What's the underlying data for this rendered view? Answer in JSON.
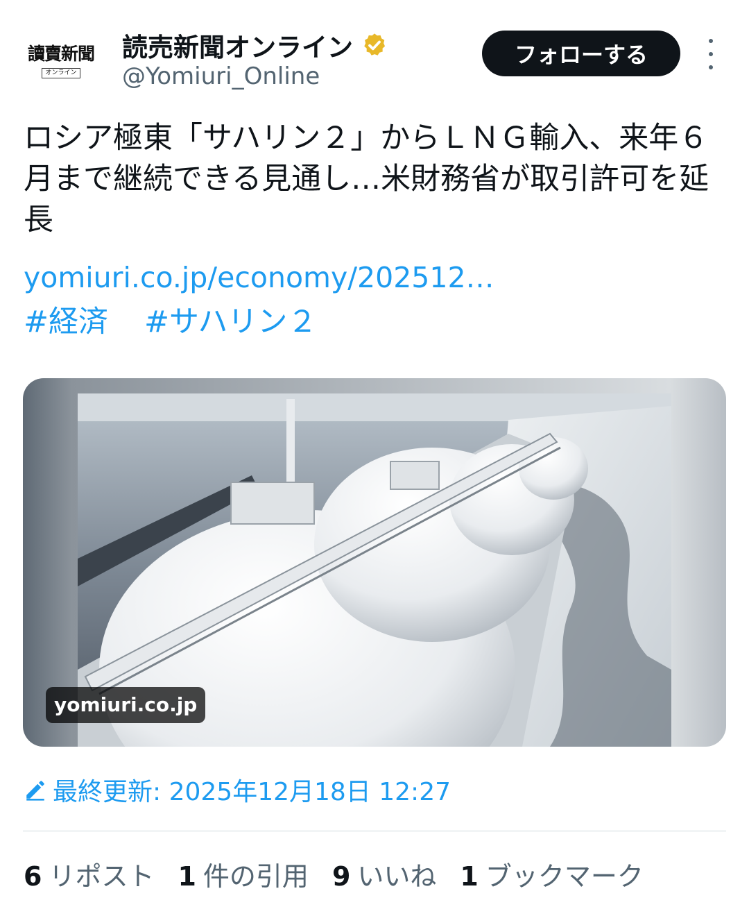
{
  "account": {
    "avatar_main": "讀賣新聞",
    "avatar_sub": "オンライン",
    "display_name": "読売新聞オンライン",
    "handle": "@Yomiuri_Online",
    "verified_icon": "verified-badge-gold",
    "follow_label": "フォローする"
  },
  "tweet": {
    "text": "ロシア極東「サハリン２」からＬＮＧ輸入、来年６月まで継続できる見通し…米財務省が取引許可を延長",
    "link": "yomiuri.co.jp/economy/202512…",
    "hashtags": [
      "#経済",
      "#サハリン２"
    ],
    "media_domain": "yomiuri.co.jp",
    "edited_label": "最終更新: 2025年12月18日 12:27"
  },
  "stats": [
    {
      "count": "6",
      "label": "リポスト"
    },
    {
      "count": "1",
      "label": "件の引用"
    },
    {
      "count": "9",
      "label": "いいね"
    },
    {
      "count": "1",
      "label": "ブックマーク"
    }
  ],
  "colors": {
    "accent": "#1d9bf0",
    "verified": "#e8b829",
    "button_bg": "#0f1419",
    "muted": "#536471"
  }
}
